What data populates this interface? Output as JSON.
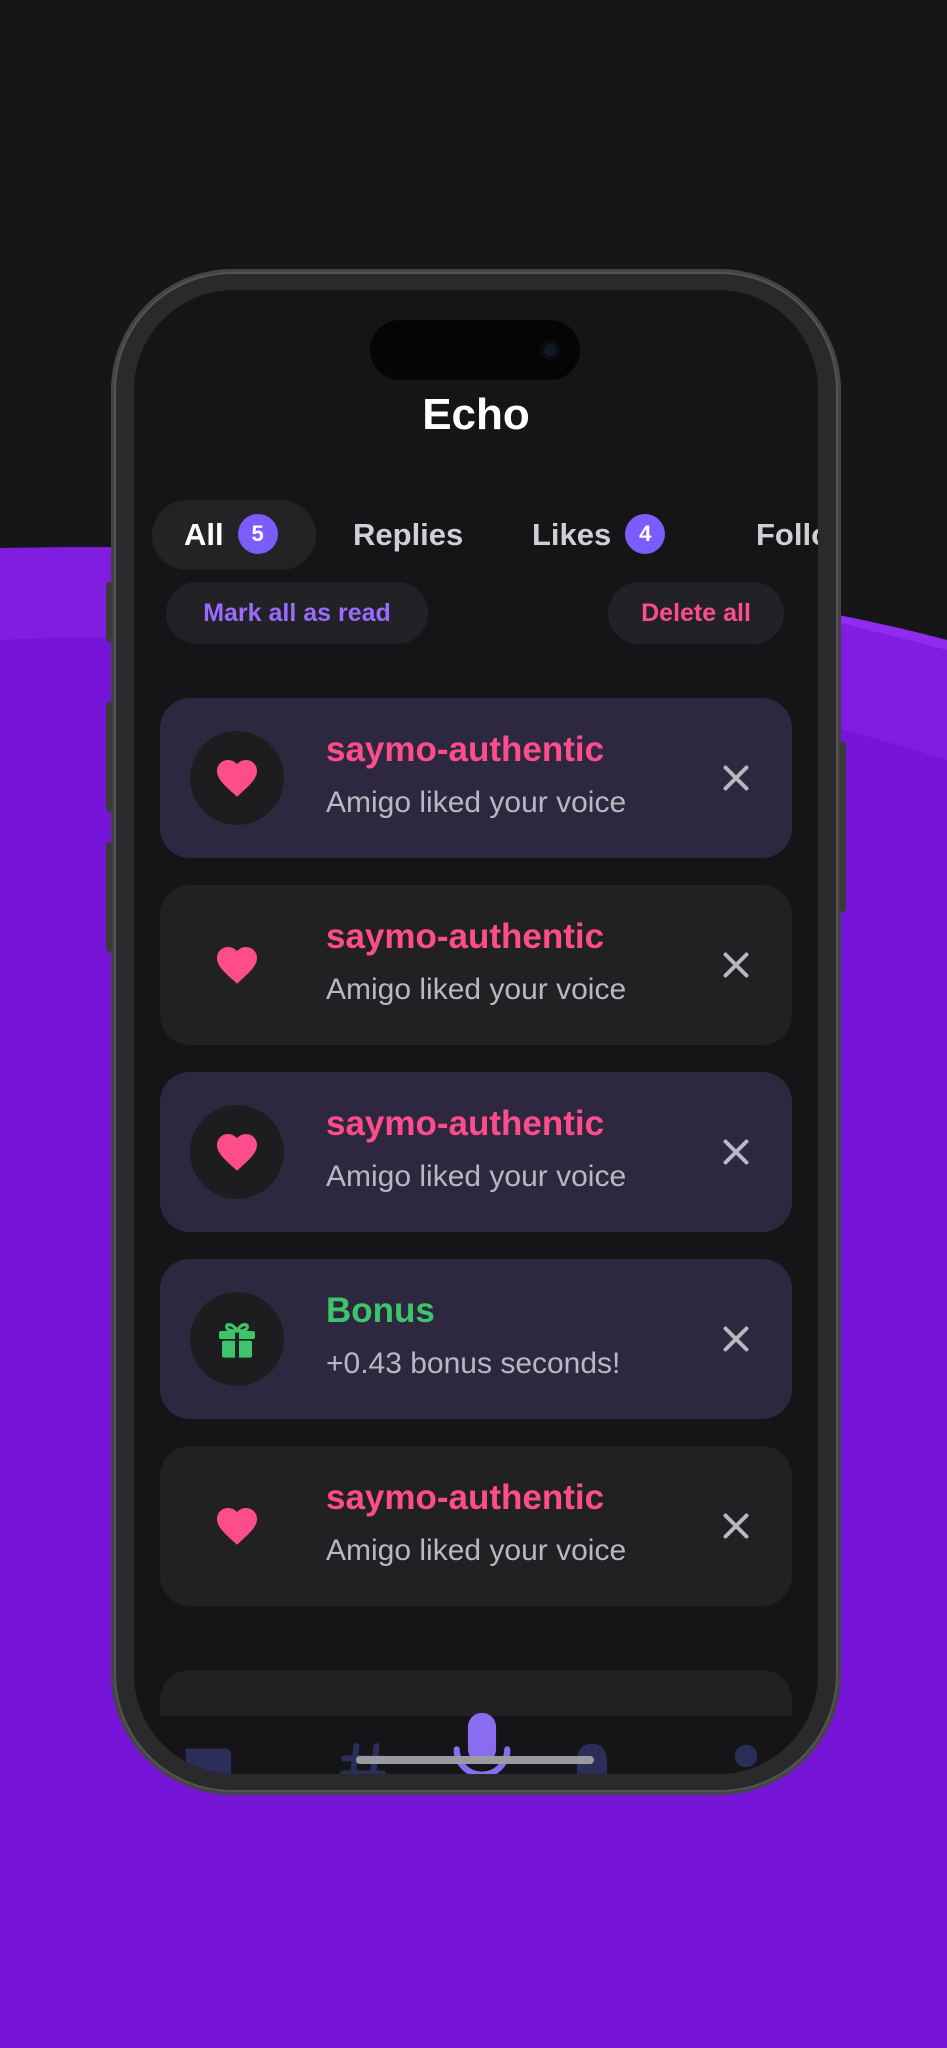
{
  "app": {
    "title": "Echo"
  },
  "tabs": [
    {
      "label": "All",
      "badge": "5",
      "active": true
    },
    {
      "label": "Replies"
    },
    {
      "label": "Likes",
      "badge": "4"
    },
    {
      "label": "Follo"
    }
  ],
  "actions": {
    "mark_all_read": "Mark all as read",
    "delete_all": "Delete all"
  },
  "notifications": [
    {
      "icon": "heart-icon",
      "title": "saymo-authentic",
      "text": "Amigo liked your voice",
      "unread": true
    },
    {
      "icon": "heart-icon",
      "title": "saymo-authentic",
      "text": "Amigo liked your voice",
      "unread": false
    },
    {
      "icon": "heart-icon",
      "title": "saymo-authentic",
      "text": "Amigo liked your voice",
      "unread": true
    },
    {
      "icon": "gift-icon",
      "title": "Bonus",
      "text": "+0.43 bonus seconds!",
      "unread": true
    },
    {
      "icon": "heart-icon",
      "title": "saymo-authentic",
      "text": "Amigo liked your voice",
      "unread": false
    }
  ],
  "nav": [
    "chat-icon",
    "hashtag-icon",
    "microphone-icon",
    "bell-icon",
    "profile-icon"
  ],
  "colors": {
    "background_purple": "#7614d8",
    "accent_purple": "#7a5cff",
    "like_pink": "#ff4d8b",
    "bonus_green": "#3ec46a",
    "screen_bg": "#151517"
  }
}
